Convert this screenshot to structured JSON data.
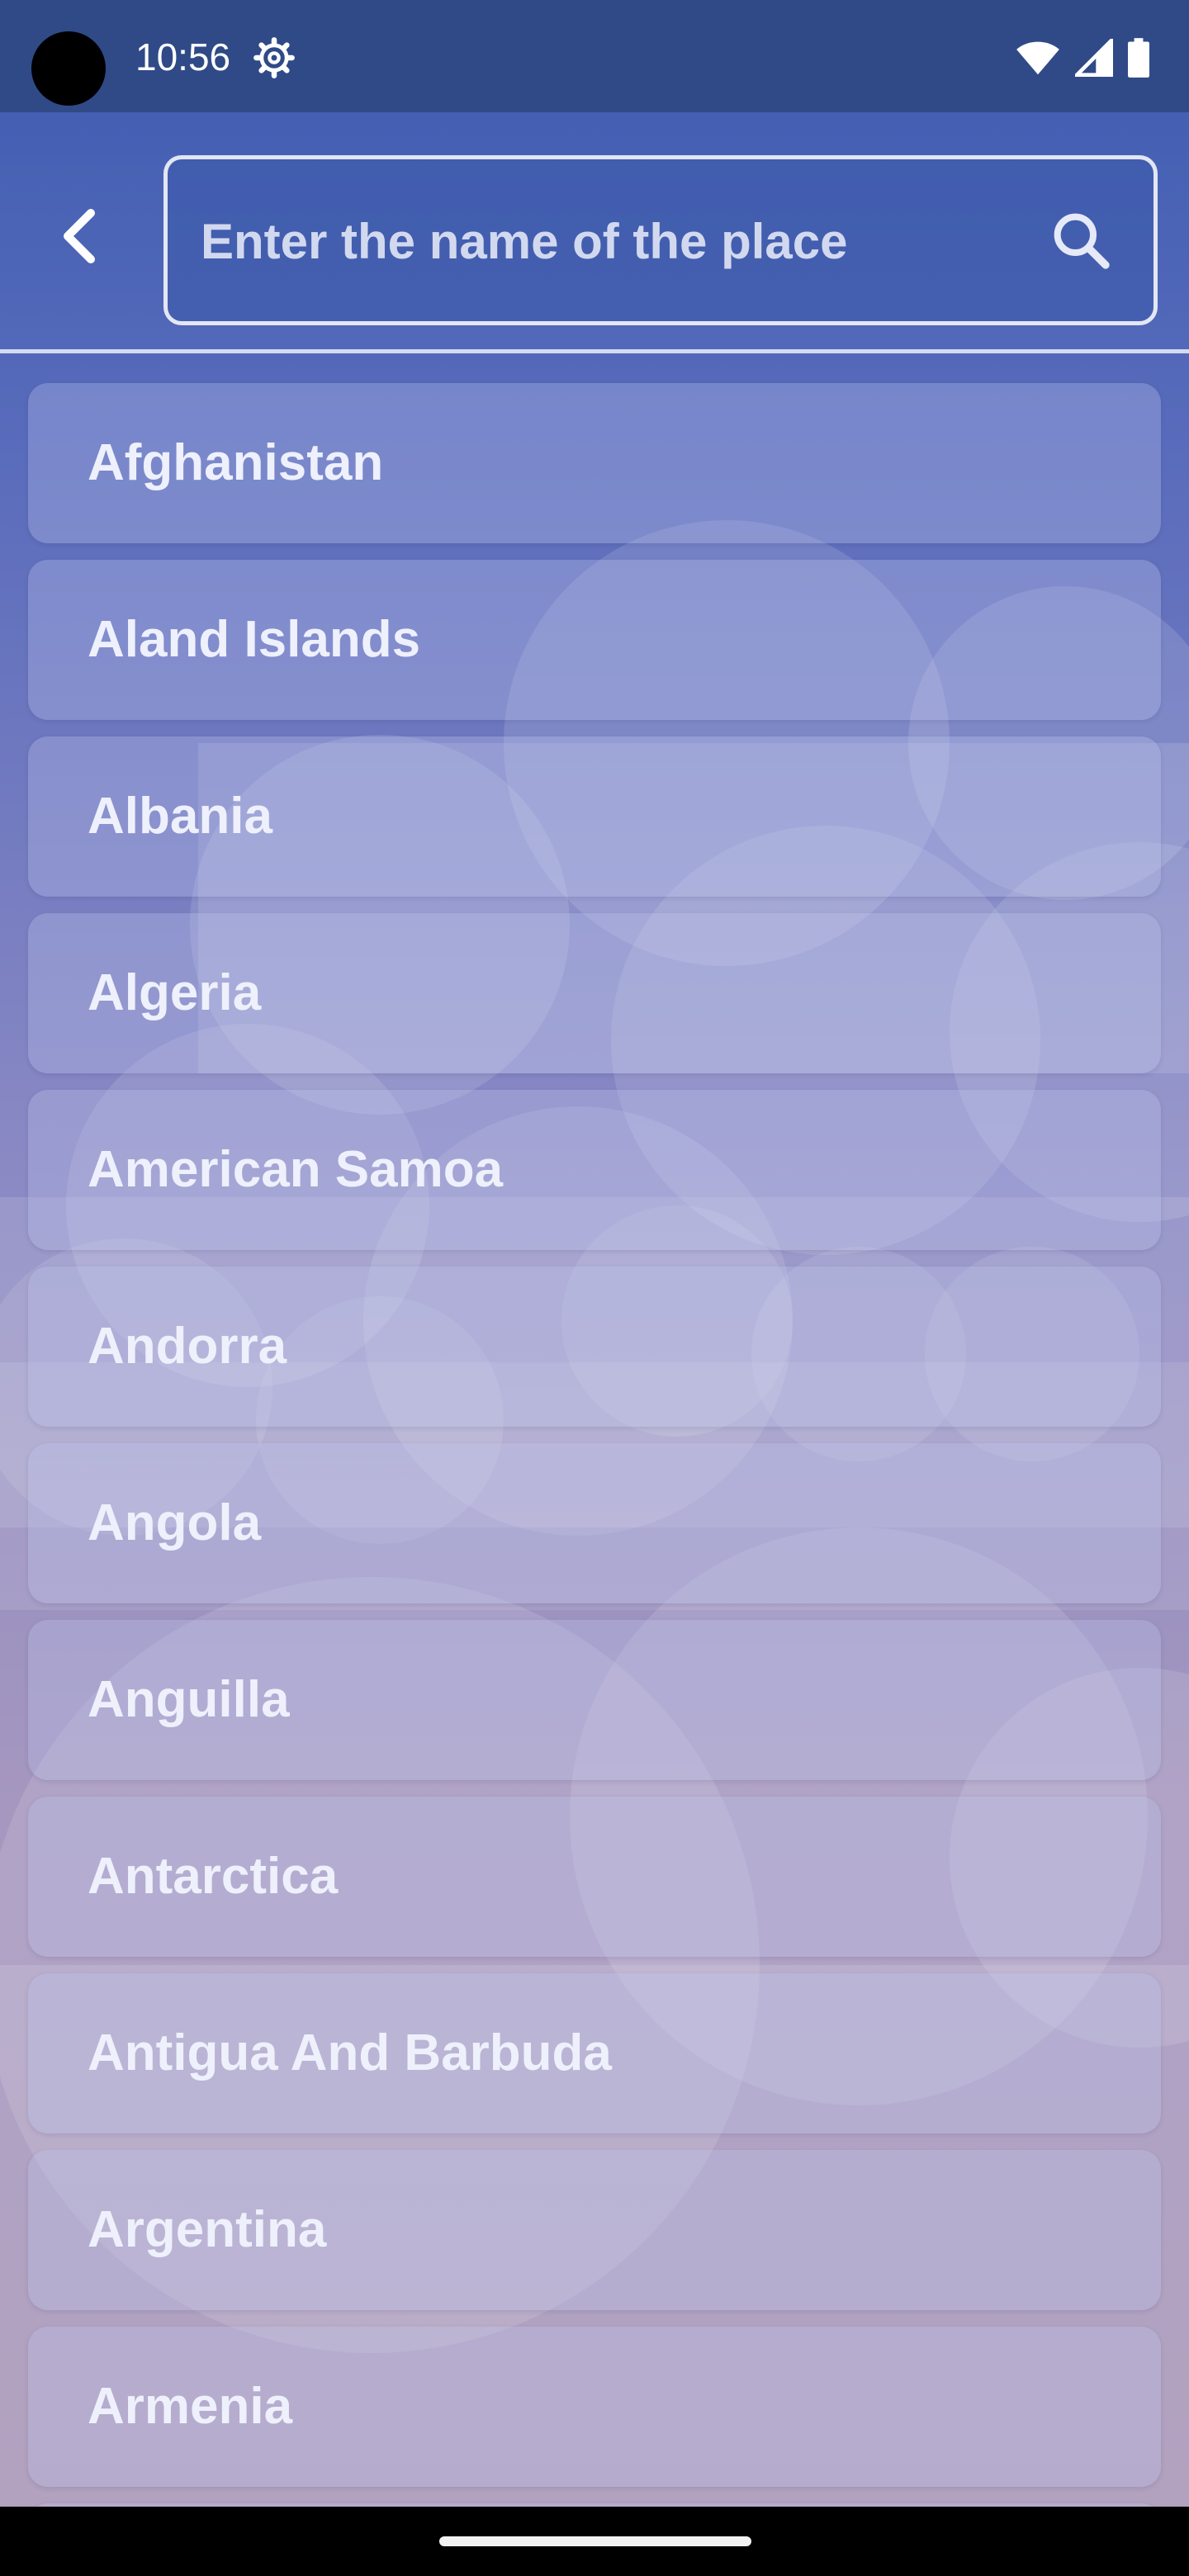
{
  "status_bar": {
    "time": "10:56",
    "icons": [
      "settings-gear-icon",
      "wifi-icon",
      "cellular-signal-icon",
      "battery-icon"
    ]
  },
  "header": {
    "back_icon": "chevron-left-icon",
    "search": {
      "placeholder": "Enter the name of the place",
      "value": "",
      "icon": "search-icon"
    }
  },
  "countries": [
    {
      "label": "Afghanistan"
    },
    {
      "label": "Aland Islands"
    },
    {
      "label": "Albania"
    },
    {
      "label": "Algeria"
    },
    {
      "label": "American Samoa"
    },
    {
      "label": "Andorra"
    },
    {
      "label": "Angola"
    },
    {
      "label": "Anguilla"
    },
    {
      "label": "Antarctica"
    },
    {
      "label": "Antigua And Barbuda"
    },
    {
      "label": "Argentina"
    },
    {
      "label": "Armenia"
    }
  ],
  "colors": {
    "status_bar": "#2f4a87",
    "background_top": "#3d5cb0",
    "background_bottom": "#a895b6",
    "text": "#eef0fb"
  }
}
